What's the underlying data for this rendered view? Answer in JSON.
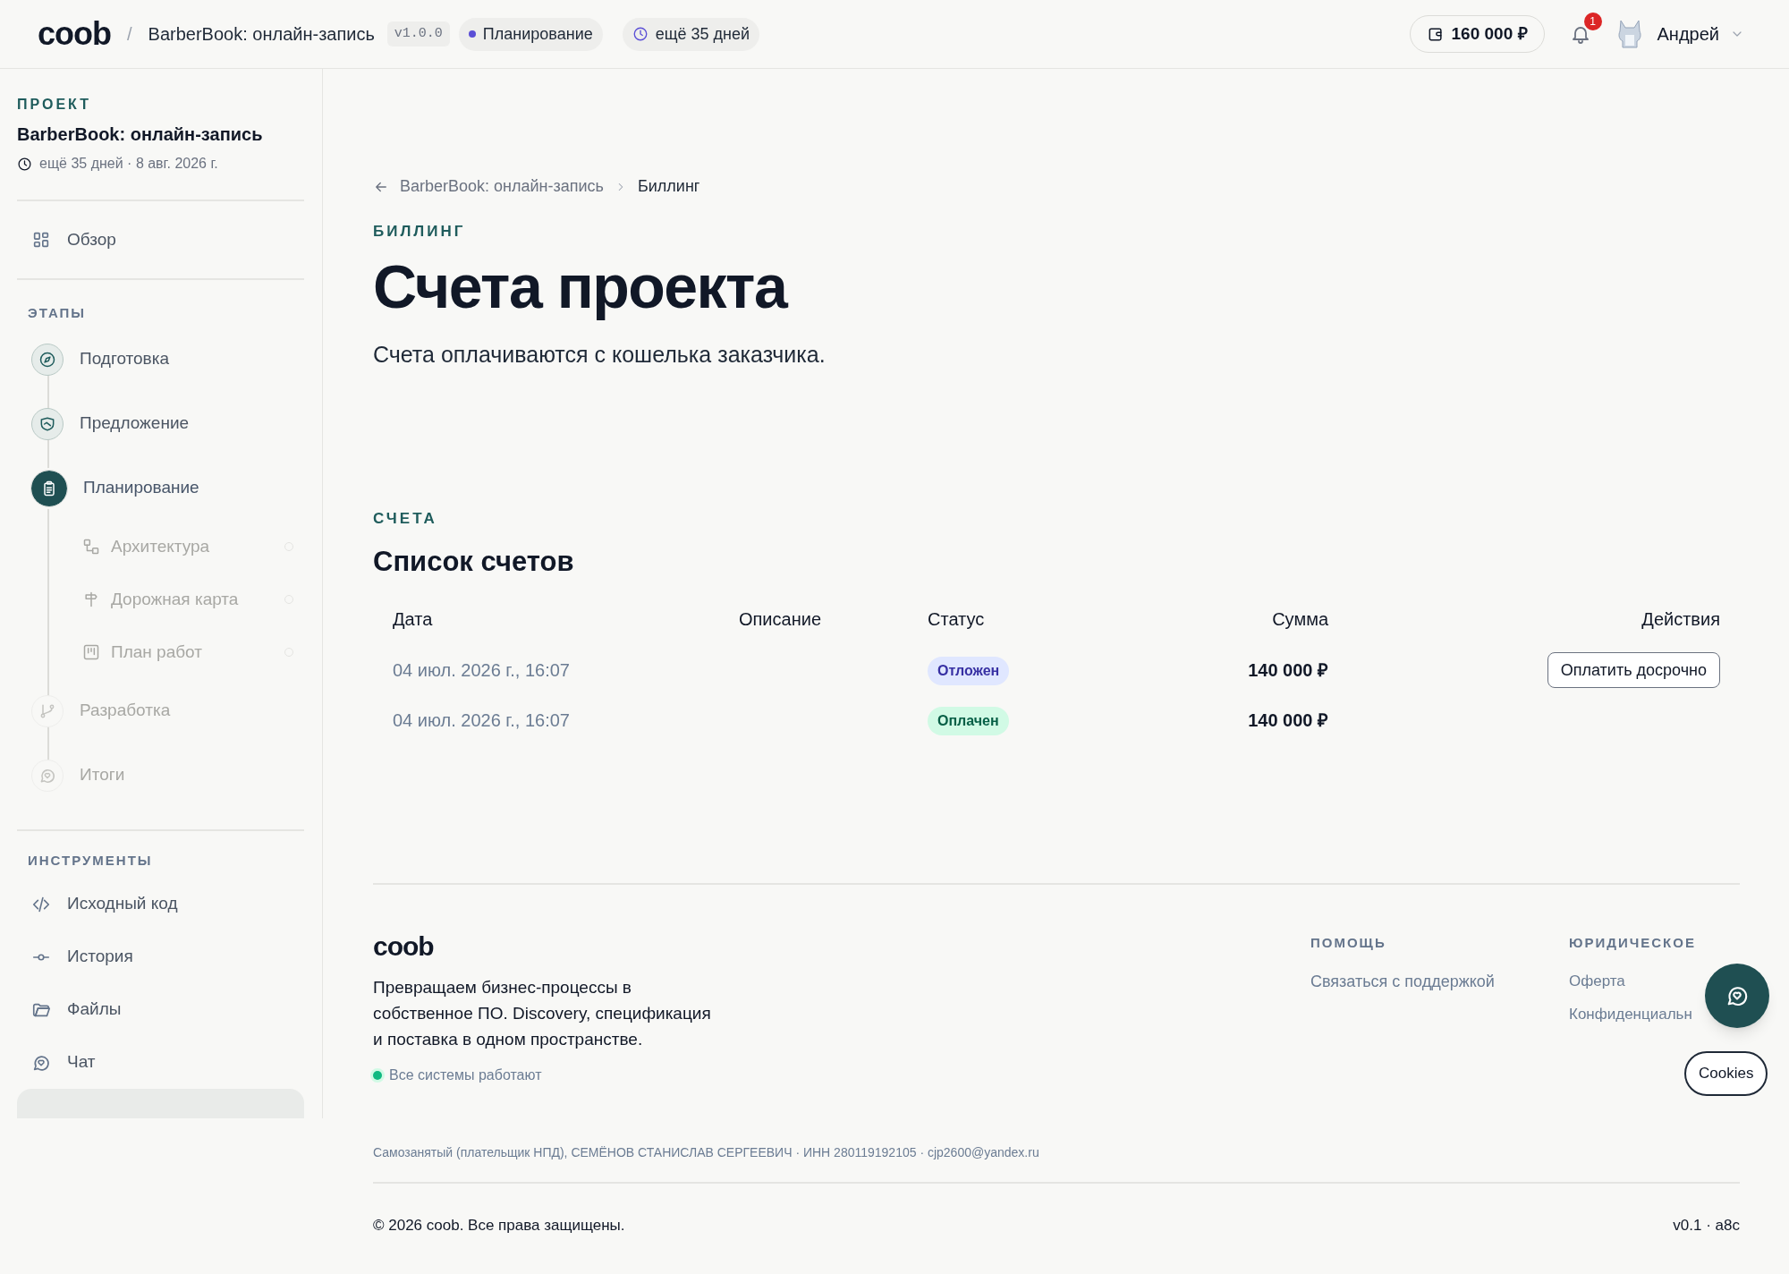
{
  "header": {
    "logo": "coob",
    "separator": "/",
    "project": "BarberBook: онлайн-запись",
    "version": "v1.0.0",
    "phase": "Планирование",
    "deadline": "ещё 35 дней",
    "balance": "160 000 ₽",
    "notifications": "1",
    "user": "Андрей"
  },
  "sidebar": {
    "section_label": "ПРОЕКТ",
    "project": "BarberBook: онлайн-запись",
    "deadline": "ещё 35 дней · 8 авг. 2026 г.",
    "overview": "Обзор",
    "stages_label": "ЭТАПЫ",
    "stages": [
      {
        "label": "Подготовка",
        "kind": "done"
      },
      {
        "label": "Предложение",
        "kind": "done"
      },
      {
        "label": "Планирование",
        "kind": "current",
        "children": [
          {
            "label": "Архитектура",
            "kind": "locked"
          },
          {
            "label": "Дорожная карта",
            "kind": "locked"
          },
          {
            "label": "План работ",
            "kind": "locked"
          }
        ]
      },
      {
        "label": "Разработка",
        "kind": "locked"
      },
      {
        "label": "Итоги",
        "kind": "locked"
      }
    ],
    "tools_label": "ИНСТРУМЕНТЫ",
    "tools": [
      {
        "label": "Исходный код"
      },
      {
        "label": "История"
      },
      {
        "label": "Файлы"
      },
      {
        "label": "Чат"
      }
    ]
  },
  "page": {
    "breadcrumb": [
      "BarberBook: онлайн-запись",
      "Биллинг"
    ],
    "eyebrow": "БИЛЛИНГ",
    "title": "Счета проекта",
    "subtitle": "Счета оплачиваются с кошелька заказчика."
  },
  "invoices": {
    "eyebrow": "СЧЕТА",
    "title": "Список счетов",
    "columns": [
      "Дата",
      "Описание",
      "Статус",
      "Сумма",
      "Действия"
    ],
    "rows": [
      {
        "date": "04 июл. 2026 г., 16:07",
        "status": "Отложен",
        "kind": "deferred",
        "amount": "140 000 ₽",
        "action": "Оплатить досрочно"
      },
      {
        "date": "04 июл. 2026 г., 16:07",
        "status": "Оплачен",
        "kind": "paid",
        "amount": "140 000 ₽"
      }
    ]
  },
  "footer": {
    "logo": "coob",
    "tagline": "Превращаем бизнес-процессы в собственное ПО. Discovery, спецификация и поставка в одном пространстве.",
    "system_status": "Все системы работают",
    "help_heading": "ПОМОЩЬ",
    "help_links": [
      "Связаться с поддержкой"
    ],
    "legal_heading": "ЮРИДИЧЕСКОЕ",
    "legal_links": [
      "Оферта",
      "Конфиденциальн"
    ],
    "legal_text": "Самозанятый (плательщик НПД), СЕМЁНОВ СТАНИСЛАВ СЕРГЕЕВИЧ · ИНН 280119192105 · cjp2600@yandex.ru",
    "copyright": "© 2026 coob. Все права защищены.",
    "build": "v0.1 · a8c"
  },
  "cookies_button": "Cookies"
}
